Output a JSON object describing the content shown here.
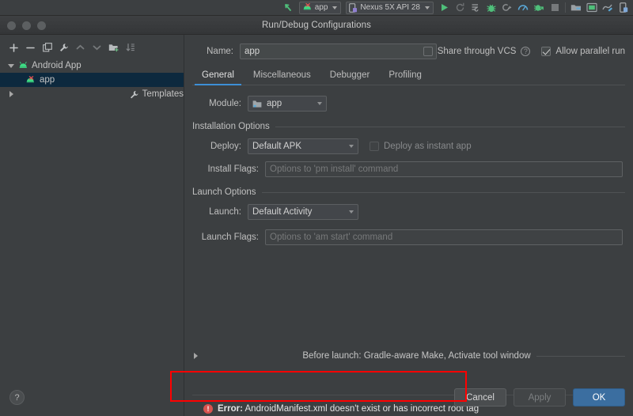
{
  "ide_toolbar": {
    "run_config_label": "app",
    "device_label": "Nexus 5X API 28",
    "icons": [
      "build-arrow-icon",
      "android-app-error-icon",
      "device-icon",
      "run-icon",
      "rerun-icon",
      "stop-run-icon",
      "debug-icon",
      "attach-debugger-icon",
      "profiler-icon",
      "apply-changes-icon",
      "stop-icon",
      "avd-manager-icon",
      "sdk-manager-icon",
      "layout-inspector-icon",
      "device-file-explorer-icon"
    ]
  },
  "window": {
    "title": "Run/Debug Configurations",
    "traffic_lights": [
      "close-button",
      "minimize-button",
      "zoom-button"
    ]
  },
  "tree_toolbar": {
    "buttons": [
      {
        "name": "add-configuration-button",
        "glyph": "+"
      },
      {
        "name": "remove-configuration-button",
        "glyph": "−"
      },
      {
        "name": "copy-configuration-button",
        "glyph": "copy-icon"
      },
      {
        "name": "edit-templates-button",
        "glyph": "wrench-icon"
      },
      {
        "name": "move-up-button",
        "glyph": "chevron-up-icon"
      },
      {
        "name": "move-down-button",
        "glyph": "chevron-down-icon"
      },
      {
        "name": "create-folder-button",
        "glyph": "folder-add-icon"
      },
      {
        "name": "sort-configurations-button",
        "glyph": "sort-icon"
      }
    ]
  },
  "tree": {
    "items": [
      {
        "label": "Android App",
        "icon": "android-icon",
        "expanded": true,
        "selected": false,
        "level": 0
      },
      {
        "label": "app",
        "icon": "android-error-icon",
        "expanded": null,
        "selected": true,
        "level": 1
      },
      {
        "label": "Templates",
        "icon": "wrench-icon",
        "expanded": false,
        "selected": false,
        "level": 0
      }
    ]
  },
  "form": {
    "name_label": "Name:",
    "name_value": "app",
    "share_vcs_label": "Share through VCS",
    "share_vcs_checked": false,
    "share_vcs_help": "?",
    "allow_parallel_label": "Allow parallel run",
    "allow_parallel_checked": true,
    "tabs": [
      {
        "label": "General",
        "active": true
      },
      {
        "label": "Miscellaneous",
        "active": false
      },
      {
        "label": "Debugger",
        "active": false
      },
      {
        "label": "Profiling",
        "active": false
      }
    ],
    "module_label": "Module:",
    "module_value": "app",
    "installation_section": "Installation Options",
    "deploy_label": "Deploy:",
    "deploy_value": "Default APK",
    "instant_app_label": "Deploy as instant app",
    "instant_app_checked": false,
    "install_flags_label": "Install Flags:",
    "install_flags_placeholder": "Options to 'pm install' command",
    "install_flags_value": "",
    "launch_section": "Launch Options",
    "launch_label": "Launch:",
    "launch_value": "Default Activity",
    "launch_flags_label": "Launch Flags:",
    "launch_flags_placeholder": "Options to 'am start' command",
    "launch_flags_value": "",
    "before_launch_text": "Before launch: Gradle-aware Make, Activate tool window"
  },
  "error": {
    "icon": "error-icon",
    "prefix": "Error:",
    "message": "AndroidManifest.xml doesn't exist or has incorrect root tag",
    "highlight_color": "#ff0000"
  },
  "footer": {
    "help_label": "?",
    "cancel_label": "Cancel",
    "apply_label": "Apply",
    "apply_disabled": true,
    "ok_label": "OK",
    "ok_color": "#3b6ea0"
  },
  "colors": {
    "background": "#3c3f41",
    "selection": "#0d293e",
    "accent": "#3d8fd6",
    "error": "#d9534f",
    "android_green": "#3ddc84"
  }
}
